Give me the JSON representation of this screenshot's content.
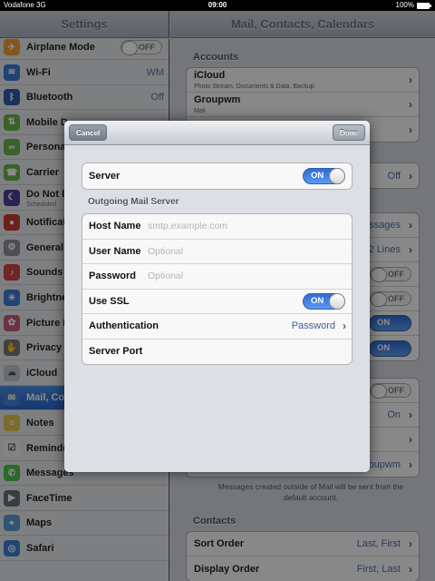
{
  "status": {
    "carrier": "Vodafone 3G",
    "time": "09:00",
    "battery": "100%"
  },
  "left_nav": {
    "title": "Settings"
  },
  "right_nav": {
    "title": "Mail, Contacts, Calendars"
  },
  "left_items": [
    {
      "label": "Airplane Mode",
      "value": "OFF",
      "icon": "airplane-icon",
      "color": "#f0a030"
    },
    {
      "label": "Wi-Fi",
      "value": "WM",
      "icon": "wifi-icon",
      "color": "#3a7bd5"
    },
    {
      "label": "Bluetooth",
      "value": "Off",
      "icon": "bluetooth-icon",
      "color": "#2f5ba8"
    },
    {
      "label": "Mobile D",
      "value": "",
      "icon": "mobile-data-icon",
      "color": "#6bb24a"
    },
    {
      "label": "Persona",
      "value": "",
      "icon": "hotspot-icon",
      "color": "#6bb24a"
    },
    {
      "label": "Carrier",
      "value": "",
      "icon": "phone-icon",
      "color": "#6bb24a"
    },
    {
      "label": "Do Not D",
      "sub": "Scheduled",
      "value": "",
      "icon": "moon-icon",
      "color": "#4b3f9c"
    },
    {
      "label": "Notificat",
      "value": "",
      "icon": "notifications-icon",
      "color": "#c83a32"
    },
    {
      "label": "General",
      "value": "",
      "icon": "gear-icon",
      "color": "#8a8f96"
    },
    {
      "label": "Sounds",
      "value": "",
      "icon": "speaker-icon",
      "color": "#d14040"
    },
    {
      "label": "Brightne",
      "value": "",
      "icon": "brightness-icon",
      "color": "#3a7bd5"
    },
    {
      "label": "Picture F",
      "value": "",
      "icon": "flower-icon",
      "color": "#c85a7a"
    },
    {
      "label": "Privacy",
      "value": "",
      "icon": "hand-icon",
      "color": "#777777"
    },
    {
      "label": "iCloud",
      "value": "",
      "icon": "cloud-icon",
      "color": "#c0c6cf"
    },
    {
      "label": "Mail, Co",
      "value": "",
      "icon": "mail-icon",
      "color": "#4a82d4"
    },
    {
      "label": "Notes",
      "value": "",
      "icon": "notes-icon",
      "color": "#e8c44a"
    },
    {
      "label": "Reminde",
      "value": "",
      "icon": "reminders-icon",
      "color": "#eeeeee"
    },
    {
      "label": "Messages",
      "value": "",
      "icon": "messages-icon",
      "color": "#4cc04c"
    },
    {
      "label": "FaceTime",
      "value": "",
      "icon": "facetime-icon",
      "color": "#6a6f76"
    },
    {
      "label": "Maps",
      "value": "",
      "icon": "maps-icon",
      "color": "#5a9ad0"
    },
    {
      "label": "Safari",
      "value": "",
      "icon": "safari-icon",
      "color": "#3d7fd6"
    }
  ],
  "right": {
    "accounts_header": "Accounts",
    "accounts": [
      {
        "label": "iCloud",
        "sub": "Photo Stream, Documents & Data, Backup"
      },
      {
        "label": "Groupwm",
        "sub": "Mail"
      },
      {
        "label": "",
        "sub": ""
      }
    ],
    "off_value": "Off",
    "mail_rows": [
      {
        "value": "ssages",
        "chevron": true
      },
      {
        "value": "2 Lines",
        "chevron": true
      },
      {
        "value": "OFF",
        "toggle": "off"
      },
      {
        "value": "OFF",
        "toggle": "off"
      },
      {
        "value": "ON",
        "toggle": "on"
      },
      {
        "value": "ON",
        "toggle": "on"
      }
    ],
    "compose_rows": [
      {
        "value": "OFF",
        "toggle": "off"
      },
      {
        "value": "On",
        "chevron": true
      },
      {
        "value": "",
        "chevron": true
      },
      {
        "value": "groupwm",
        "chevron": true
      }
    ],
    "note": "Messages created outside of Mail will be sent from the default account.",
    "contacts_header": "Contacts",
    "contacts": [
      {
        "label": "Sort Order",
        "value": "Last, First"
      },
      {
        "label": "Display Order",
        "value": "First, Last"
      }
    ]
  },
  "modal": {
    "cancel": "Cancel",
    "done": "Done",
    "server_label": "Server",
    "server_switch": "ON",
    "section_header": "Outgoing Mail Server",
    "host_label": "Host Name",
    "host_placeholder": "smtp.example.com",
    "user_label": "User Name",
    "user_placeholder": "Optional",
    "password_label": "Password",
    "password_placeholder": "Optional",
    "ssl_label": "Use SSL",
    "ssl_switch": "ON",
    "auth_label": "Authentication",
    "auth_value": "Password",
    "port_label": "Server Port"
  }
}
